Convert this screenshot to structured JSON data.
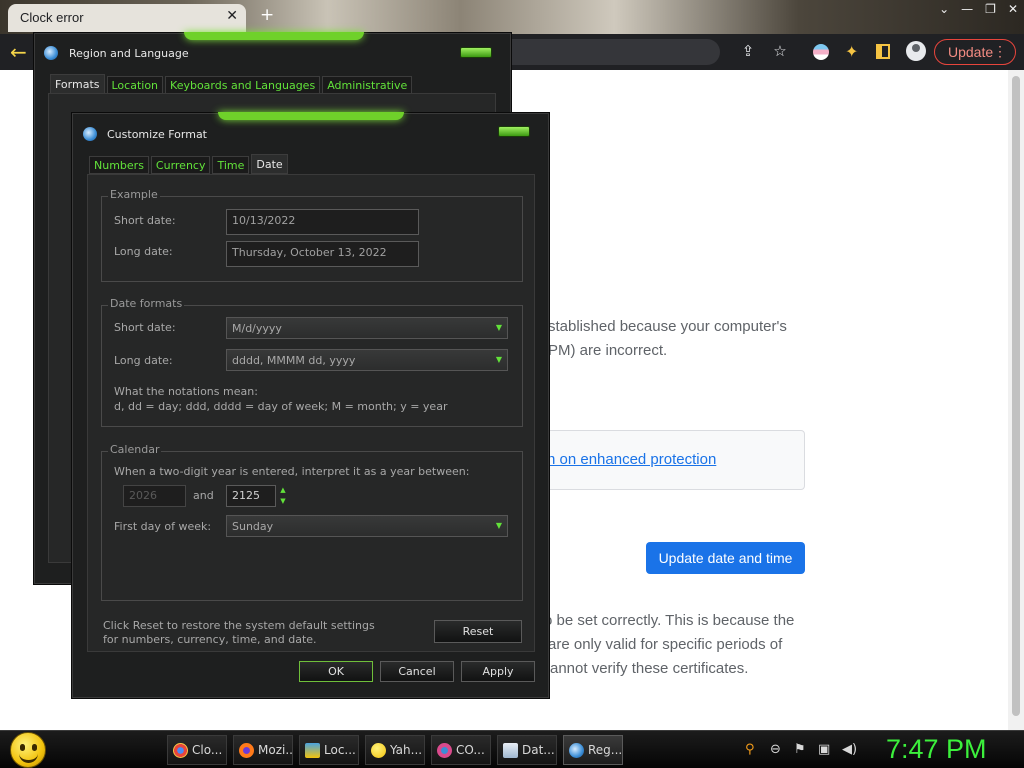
{
  "browser": {
    "tab_title": "Clock error",
    "tab_close": "✕",
    "new_tab": "+",
    "update_label": "Update",
    "window_controls": [
      "⌄",
      "—",
      "❐",
      "✕"
    ]
  },
  "page": {
    "para1": [
      "stablished because your computer's",
      "PM) are incorrect."
    ],
    "enhanced_link": "n on enhanced protection",
    "update_button": "Update date and time",
    "para2": [
      "o be set correctly. This is because the",
      "are only valid for specific periods of",
      "annot verify these certificates."
    ]
  },
  "region_dialog": {
    "title": "Region and Language",
    "tabs": [
      "Formats",
      "Location",
      "Keyboards and Languages",
      "Administrative"
    ],
    "active_tab": "Formats"
  },
  "customize_dialog": {
    "title": "Customize Format",
    "tabs": [
      "Numbers",
      "Currency",
      "Time",
      "Date"
    ],
    "active_tab": "Date",
    "example": {
      "title": "Example",
      "short_label": "Short date:",
      "short_value": "10/13/2022",
      "long_label": "Long date:",
      "long_value": "Thursday, October 13, 2022"
    },
    "formats": {
      "title": "Date formats",
      "short_label": "Short date:",
      "short_value": "M/d/yyyy",
      "long_label": "Long date:",
      "long_value": "dddd, MMMM dd, yyyy",
      "notation_title": "What the notations mean:",
      "notation_text": "d, dd = day;  ddd, dddd = day of week;  M = month;  y = year"
    },
    "calendar": {
      "title": "Calendar",
      "two_digit_text": "When a two-digit year is entered, interpret it as a year between:",
      "year_from": "2026",
      "and_label": "and",
      "year_to": "2125",
      "first_day_label": "First day of week:",
      "first_day_value": "Sunday"
    },
    "reset_text": "Click Reset to restore the system default settings for numbers, currency, time, and date.",
    "reset_button": "Reset",
    "ok_button": "OK",
    "cancel_button": "Cancel",
    "apply_button": "Apply"
  },
  "taskbar": {
    "items": [
      {
        "label": "Clo...",
        "icon_color": "#e8453c"
      },
      {
        "label": "Mozi...",
        "icon_color": "#ff7a1a"
      },
      {
        "label": "Loc...",
        "icon_color": "#4aa3df"
      },
      {
        "label": "Yah...",
        "icon_color": "#f2c20c"
      },
      {
        "label": "CO...",
        "icon_color": "#d94a8c"
      },
      {
        "label": "Dat...",
        "icon_color": "#9fb7d0"
      },
      {
        "label": "Reg...",
        "icon_color": "#3a8dd6"
      }
    ],
    "clock": "7:47 PM"
  },
  "colors": {
    "accent_green": "#62e23a",
    "clock_green": "#3cf03c",
    "link_blue": "#1a73e8"
  }
}
